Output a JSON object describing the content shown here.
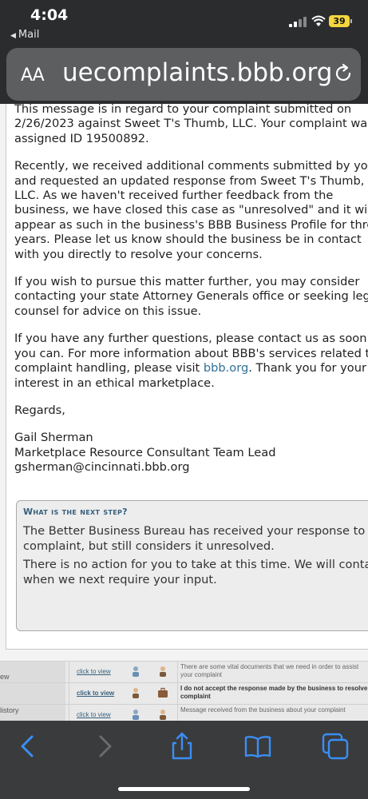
{
  "status_bar": {
    "time": "4:04",
    "back_app": "Mail",
    "battery": "39",
    "icons": [
      "signal-icon",
      "wifi-icon",
      "battery-icon"
    ]
  },
  "address_bar": {
    "text_size_label": "AA",
    "url": "uecomplaints.bbb.org",
    "icons": [
      "reload-icon"
    ]
  },
  "message": {
    "para1": [
      "This message is in regard to your complaint submitted on",
      "2/26/2023 against Sweet T's Thumb, LLC.  Your complaint was",
      "assigned ID 19500892."
    ],
    "para2": [
      "Recently, we received additional comments submitted by you",
      "and requested an updated response from Sweet T's Thumb,",
      "LLC.   As we haven't received further feedback from the",
      "business, we have closed this case as \"unresolved\" and it will",
      "appear as such in the business's BBB Business Profile for three",
      "years. Please let us know should the business be in contact",
      "with you directly to resolve your concerns."
    ],
    "para3": [
      "If you wish to pursue this matter further, you may consider",
      "contacting your state Attorney Generals office or seeking legal",
      "counsel for advice on this issue."
    ],
    "para4_line1": "If you have any further questions, please contact us as soon as",
    "para4_line2": "you can.  For more information about BBB's services related to",
    "para4_line3_pre": "complaint handling, please visit ",
    "para4_link": "bbb.org",
    "para4_line3_post": ".  Thank you for your",
    "para4_line4": "interest in an ethical marketplace.",
    "closing": "Regards,",
    "sender_name": "Gail Sherman",
    "sender_title": "Marketplace Resource Consultant Team Lead",
    "sender_email": "gsherman@cincinnati.bbb.org"
  },
  "next_step": {
    "title": "What is the next step?",
    "line1": "The Better Business Bureau has received your response to the",
    "line2": "complaint, but still considers it unresolved.",
    "line3": "There is no action for you to take at this time. We will contact you",
    "line4": "when we next require your input."
  },
  "history": {
    "rows": [
      {
        "left": "ew",
        "link": "click to view",
        "message": "There are some vital documents that we need in order to assist",
        "message2": "your complaint",
        "bold": false
      },
      {
        "left": "",
        "link": "click to view",
        "message": "I do not accept the response made by the business to resolve",
        "message2": "complaint",
        "bold": true
      },
      {
        "left": "listory",
        "link": "click to view",
        "message": "Message received from the business about your complaint",
        "message2": "",
        "bold": false
      }
    ],
    "icons": [
      "person-icon",
      "briefcase-icon"
    ]
  },
  "toolbar": {
    "icons": [
      "back-icon",
      "forward-icon",
      "share-icon",
      "bookmarks-icon",
      "tabs-icon"
    ]
  }
}
